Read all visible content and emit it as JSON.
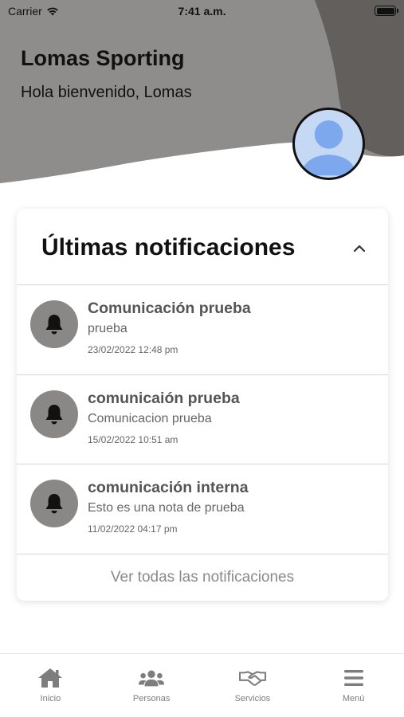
{
  "status_bar": {
    "carrier": "Carrier",
    "time": "7:41 a.m."
  },
  "header": {
    "app_title": "Lomas Sporting",
    "welcome": "Hola bienvenido, Lomas",
    "bg_light": "#8f8d8b",
    "bg_dark": "#625f5d"
  },
  "notifications_card": {
    "title": "Últimas notificaciones",
    "items": [
      {
        "title": "Comunicación prueba",
        "body": "prueba",
        "date": "23/02/2022 12:48 pm"
      },
      {
        "title": "comunicaión prueba",
        "body": "Comunicacion prueba",
        "date": "15/02/2022 10:51 am"
      },
      {
        "title": "comunicación interna",
        "body": "Esto es una nota de prueba",
        "date": "11/02/2022 04:17 pm"
      }
    ],
    "view_all": "Ver todas las notificaciones",
    "icon": "bell-icon",
    "icon_bg": "#8a8886"
  },
  "tabbar": {
    "items": [
      {
        "label": "Inicio",
        "icon": "home-icon"
      },
      {
        "label": "Personas",
        "icon": "people-icon"
      },
      {
        "label": "Servicios",
        "icon": "handshake-icon"
      },
      {
        "label": "Menú",
        "icon": "menu-icon"
      }
    ]
  }
}
